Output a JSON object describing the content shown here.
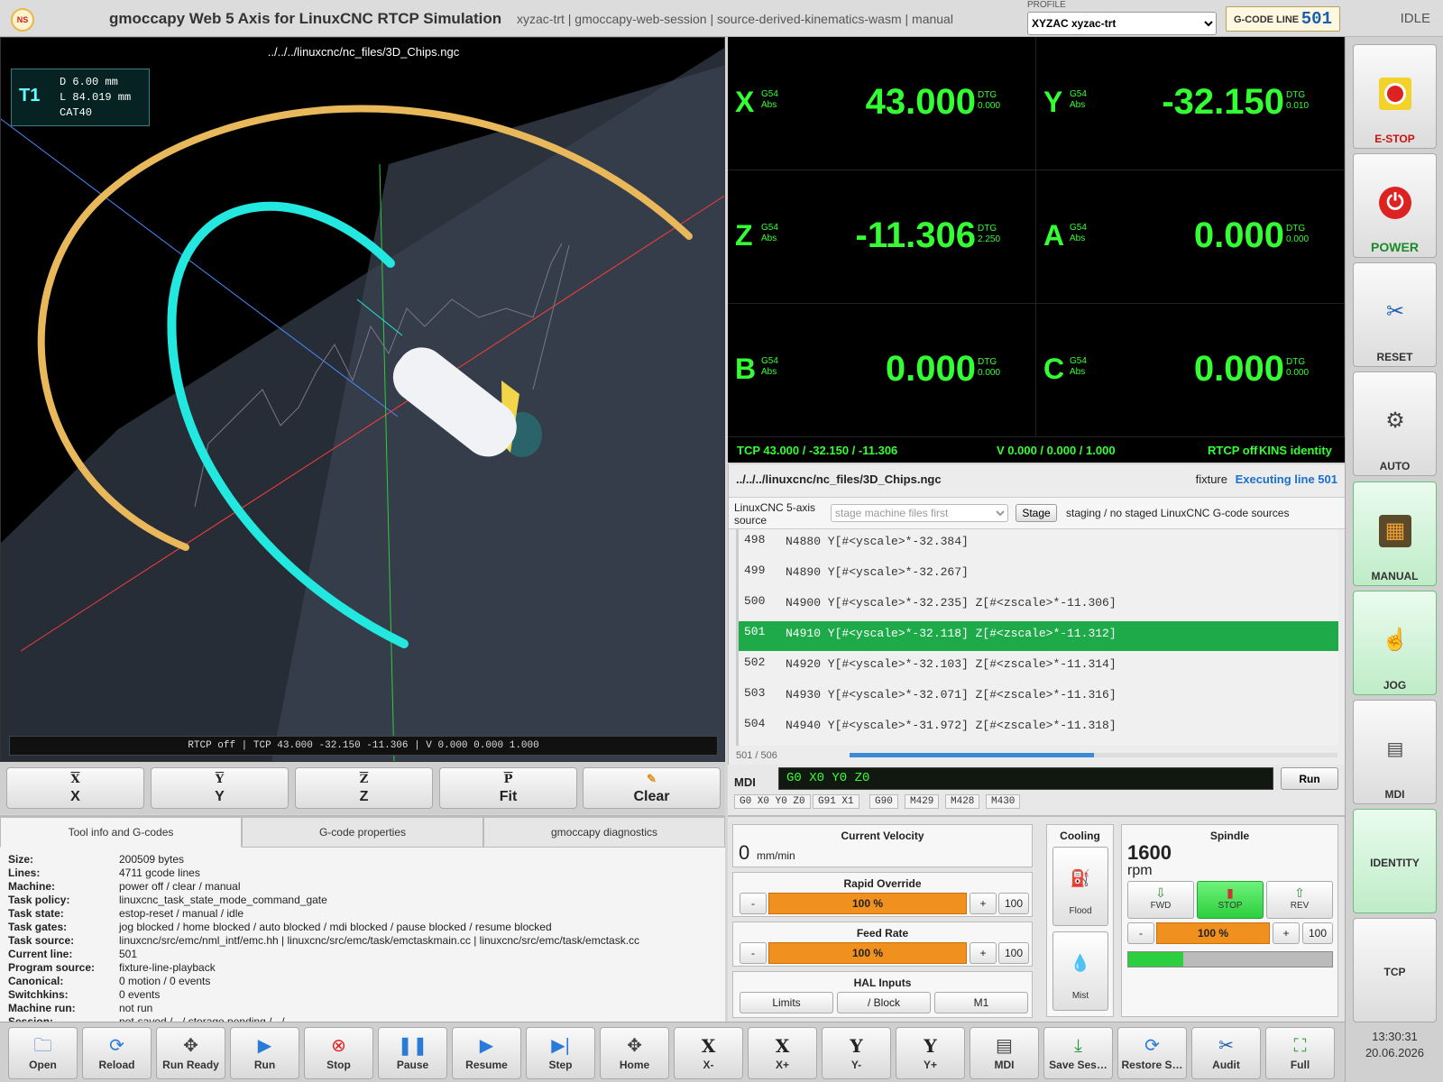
{
  "header": {
    "logo": "NS",
    "title": "gmoccapy Web 5 Axis for LinuxCNC RTCP Simulation",
    "subtitle": "xyzac-trt | gmoccapy-web-session | source-derived-kinematics-wasm | manual",
    "profile_label": "PROFILE",
    "profile_value": "XYZAC xyzac-trt",
    "gcode_line_label": "G-CODE LINE",
    "gcode_line_value": "501",
    "state": "IDLE"
  },
  "view": {
    "file": "../../../linuxcnc/nc_files/3D_Chips.ngc",
    "tool": {
      "name": "T1",
      "diameter": "D 6.00 mm",
      "length": "L 84.019 mm",
      "holder": "CAT40"
    },
    "status": "RTCP off | TCP 43.000 -32.150 -11.306 | V 0.000 0.000 1.000",
    "buttons": [
      {
        "icon": "X",
        "label": "X"
      },
      {
        "icon": "Y",
        "label": "Y"
      },
      {
        "icon": "Z",
        "label": "Z"
      },
      {
        "icon": "P",
        "label": "Fit"
      },
      {
        "icon": "✎",
        "label": "Clear"
      }
    ]
  },
  "dro": {
    "axes": [
      {
        "axis": "X",
        "cs": "G54",
        "mode": "Abs",
        "value": "43.000",
        "dtg_label": "DTG",
        "dtg": "0.000"
      },
      {
        "axis": "Y",
        "cs": "G54",
        "mode": "Abs",
        "value": "-32.150",
        "dtg_label": "DTG",
        "dtg": "0.010"
      },
      {
        "axis": "Z",
        "cs": "G54",
        "mode": "Abs",
        "value": "-11.306",
        "dtg_label": "DTG",
        "dtg": "2.250"
      },
      {
        "axis": "A",
        "cs": "G54",
        "mode": "Abs",
        "value": "0.000",
        "dtg_label": "DTG",
        "dtg": "0.000"
      },
      {
        "axis": "B",
        "cs": "G54",
        "mode": "Abs",
        "value": "0.000",
        "dtg_label": "DTG",
        "dtg": "0.000"
      },
      {
        "axis": "C",
        "cs": "G54",
        "mode": "Abs",
        "value": "0.000",
        "dtg_label": "DTG",
        "dtg": "0.000"
      }
    ],
    "tcp": "TCP 43.000 / -32.150 / -11.306",
    "vector": "V 0.000 / 0.000 / 1.000",
    "rtcp": "RTCP off",
    "kins": "KINS identity"
  },
  "program": {
    "file": "../../../linuxcnc/nc_files/3D_Chips.ngc",
    "fixture": "fixture",
    "executing": "Executing line 501",
    "source_label": "LinuxCNC 5-axis source",
    "source_placeholder": "stage machine files first",
    "stage_button": "Stage",
    "source_status": "staging / no staged LinuxCNC G-code sources",
    "lines": [
      {
        "n": "498",
        "code": "N4880 Y[#<yscale>*-32.384]"
      },
      {
        "n": "499",
        "code": "N4890 Y[#<yscale>*-32.267]"
      },
      {
        "n": "500",
        "code": "N4900 Y[#<yscale>*-32.235] Z[#<zscale>*-11.306]"
      },
      {
        "n": "501",
        "code": "N4910 Y[#<yscale>*-32.118] Z[#<zscale>*-11.312]"
      },
      {
        "n": "502",
        "code": "N4920 Y[#<yscale>*-32.103] Z[#<zscale>*-11.314]"
      },
      {
        "n": "503",
        "code": "N4930 Y[#<yscale>*-32.071] Z[#<zscale>*-11.316]"
      },
      {
        "n": "504",
        "code": "N4940 Y[#<yscale>*-31.972] Z[#<zscale>*-11.318]"
      }
    ],
    "current_index": 3,
    "count": "501 / 506",
    "progress": 0.5
  },
  "mdi": {
    "label": "MDI",
    "value": "G0 X0 Y0 Z0",
    "run": "Run",
    "history": [
      "G0 X0 Y0 Z0",
      "G91 X1",
      "G90",
      "M429",
      "M428",
      "M430"
    ]
  },
  "info": {
    "tabs": [
      "Tool info and G-codes",
      "G-code properties",
      "gmoccapy diagnostics"
    ],
    "rows": [
      {
        "k": "Size:",
        "v": "200509 bytes"
      },
      {
        "k": "Lines:",
        "v": "4711 gcode lines"
      },
      {
        "k": "Machine:",
        "v": "power off / clear / manual"
      },
      {
        "k": "Task policy:",
        "v": "linuxcnc_task_state_mode_command_gate"
      },
      {
        "k": "Task state:",
        "v": "estop-reset / manual / idle"
      },
      {
        "k": "Task gates:",
        "v": "jog blocked / home blocked / auto blocked / mdi blocked / pause blocked / resume blocked"
      },
      {
        "k": "Task source:",
        "v": "linuxcnc/src/emc/nml_intf/emc.hh | linuxcnc/src/emc/task/emctaskmain.cc | linuxcnc/src/emc/task/emctask.cc"
      },
      {
        "k": "Current line:",
        "v": "501"
      },
      {
        "k": "Program source:",
        "v": "fixture-line-playback"
      },
      {
        "k": "Canonical:",
        "v": "0 motion / 0 events"
      },
      {
        "k": "Switchkins:",
        "v": "0 events"
      },
      {
        "k": "Machine run:",
        "v": "not run"
      },
      {
        "k": "Session:",
        "v": "not-saved / - / storage pending / - / -"
      }
    ]
  },
  "controls": {
    "velocity_title": "Current Velocity",
    "velocity_value": "0",
    "velocity_unit": "mm/min",
    "rapid_title": "Rapid Override",
    "rapid_value": "100 %",
    "rapid_level": 1.0,
    "feed_title": "Feed Rate",
    "feed_value": "100 %",
    "feed_level": 1.0,
    "minus": "-",
    "plus": "+",
    "reset100": "100",
    "hal_title": "HAL Inputs",
    "hal_buttons": [
      "Limits",
      "/ Block",
      "M1"
    ],
    "cooling_title": "Cooling",
    "flood": "Flood",
    "mist": "Mist",
    "spindle_title": "Spindle",
    "spindle_speed": "1600",
    "spindle_unit": "rpm",
    "fwd": "FWD",
    "stop": "STOP",
    "rev": "REV",
    "spindle_override": "100 %",
    "spindle_load": 0.27
  },
  "sidebar": {
    "buttons": [
      "E-STOP",
      "POWER",
      "RESET",
      "AUTO",
      "MANUAL",
      "JOG",
      "MDI",
      "IDENTITY",
      "TCP"
    ],
    "time": "13:30:31",
    "date": "20.06.2026"
  },
  "toolbar": {
    "buttons": [
      "Open",
      "Reload",
      "Run Ready",
      "Run",
      "Stop",
      "Pause",
      "Resume",
      "Step",
      "Home",
      "X-",
      "X+",
      "Y-",
      "Y+",
      "MDI",
      "Save Ses…",
      "Restore S…",
      "Audit",
      "Full"
    ]
  },
  "colors": {
    "dro_green": "#33ff33",
    "current_line": "#1faa4a",
    "override": "#f0901e",
    "executing": "#1a6fd0"
  }
}
